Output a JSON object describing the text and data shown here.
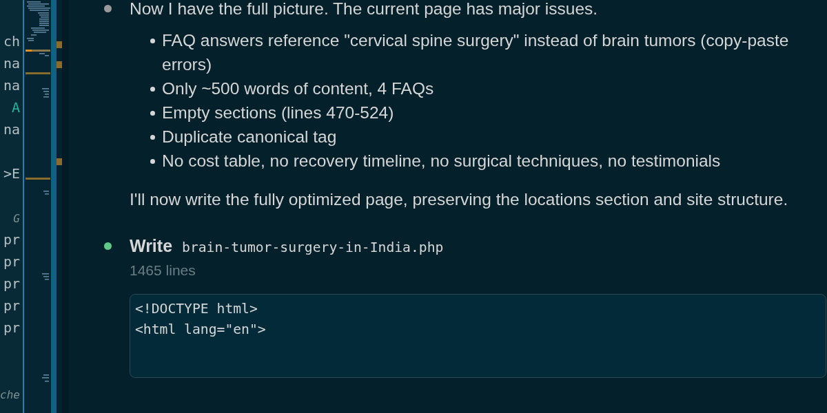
{
  "editor": {
    "lines": [
      {
        "kind": "code",
        "tokens": [
          {
            "kind": "plain",
            "text": "ch"
          }
        ]
      },
      {
        "kind": "code",
        "tokens": [
          {
            "kind": "plain",
            "text": "na"
          }
        ]
      },
      {
        "kind": "code",
        "tokens": [
          {
            "kind": "plain",
            "text": "na"
          }
        ]
      },
      {
        "kind": "code",
        "tokens": [
          {
            "kind": "keyword",
            "text": "A"
          }
        ]
      },
      {
        "kind": "code",
        "tokens": [
          {
            "kind": "plain",
            "text": "na"
          }
        ]
      },
      {
        "kind": "blank"
      },
      {
        "kind": "code",
        "tokens": [
          {
            "kind": "plain",
            "text": ">E"
          }
        ]
      },
      {
        "kind": "blank"
      },
      {
        "kind": "code",
        "tokens": [
          {
            "kind": "comment",
            "text": "G"
          }
        ]
      },
      {
        "kind": "code",
        "tokens": [
          {
            "kind": "plain",
            "text": "pr"
          }
        ]
      },
      {
        "kind": "code",
        "tokens": [
          {
            "kind": "plain",
            "text": "pr"
          }
        ]
      },
      {
        "kind": "code",
        "tokens": [
          {
            "kind": "plain",
            "text": "pr"
          }
        ]
      },
      {
        "kind": "code",
        "tokens": [
          {
            "kind": "plain",
            "text": "pr"
          }
        ]
      },
      {
        "kind": "code",
        "tokens": [
          {
            "kind": "plain",
            "text": "pr"
          }
        ]
      },
      {
        "kind": "blank"
      },
      {
        "kind": "blank"
      },
      {
        "kind": "code",
        "tokens": [
          {
            "kind": "comment",
            "text": "che"
          }
        ]
      }
    ]
  },
  "conversation": {
    "entries": [
      {
        "kind": "message",
        "color": "#9a9a9a",
        "intro": "Now I have the full picture. The current page has major issues.",
        "bullets": [
          "FAQ answers reference \"cervical spine surgery\" instead of brain tumors (copy-paste errors)",
          "Only ~500 words of content, 4 FAQs",
          "Empty sections (lines 470-524)",
          "Duplicate canonical tag",
          "No cost table, no recovery timeline, no surgical techniques, no testimonials"
        ],
        "closing": "I'll now write the fully optimized page, preserving the locations section and site structure."
      },
      {
        "kind": "tool",
        "color": "#5fc98a",
        "action": "Write",
        "file": "brain-tumor-surgery-in-India.php",
        "summary": "1465 lines",
        "preview": [
          "<!DOCTYPE html>",
          "<html lang=\"en\">"
        ]
      }
    ]
  }
}
